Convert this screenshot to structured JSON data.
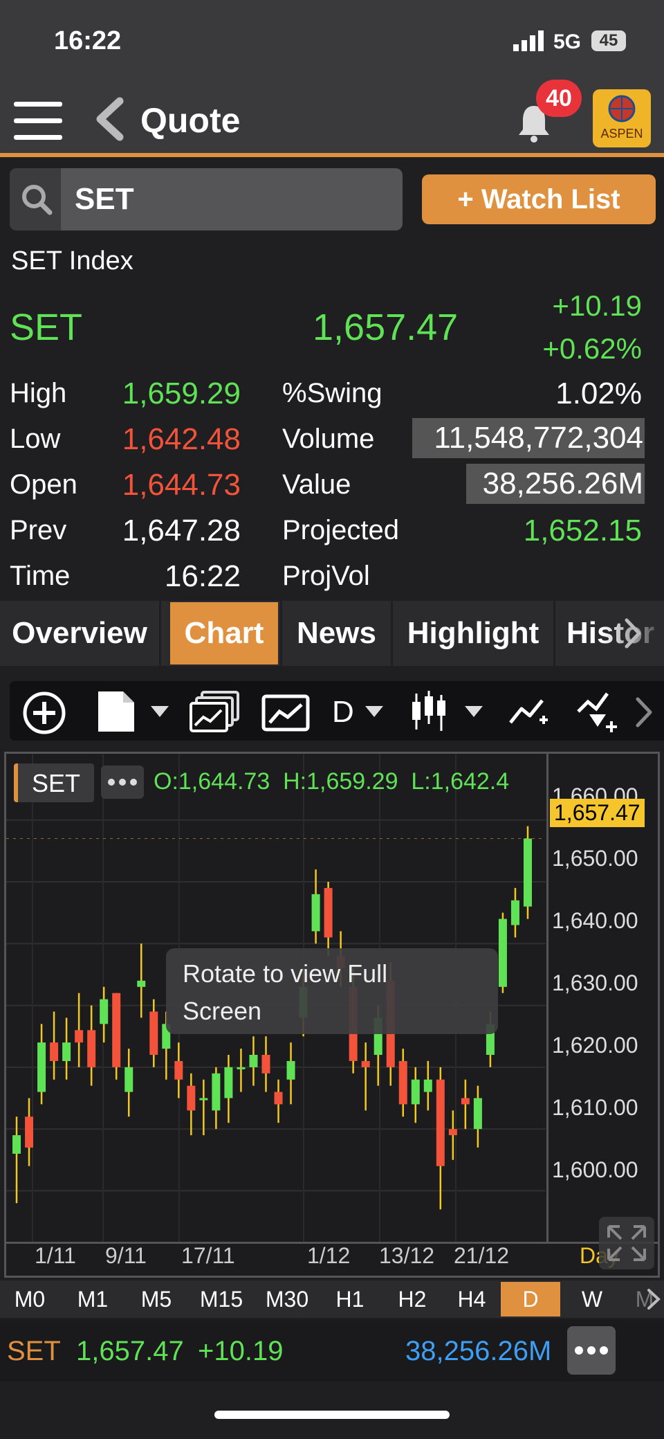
{
  "status": {
    "time": "16:22",
    "network": "5G",
    "battery": "45"
  },
  "header": {
    "title": "Quote",
    "notifications": "40",
    "brand": "ASPEN"
  },
  "search": {
    "value": "SET",
    "watchlist_label": "+ Watch List"
  },
  "quote": {
    "name": "SET Index",
    "symbol": "SET",
    "last": "1,657.47",
    "change": "+10.19",
    "change_pct": "+0.62%",
    "high_label": "High",
    "high": "1,659.29",
    "low_label": "Low",
    "low": "1,642.48",
    "open_label": "Open",
    "open": "1,644.73",
    "prev_label": "Prev",
    "prev": "1,647.28",
    "time_label": "Time",
    "time": "16:22",
    "swing_label": "%Swing",
    "swing": "1.02%",
    "volume_label": "Volume",
    "volume": "11,548,772,304",
    "value_label": "Value",
    "value": "38,256.26M",
    "projected_label": "Projected",
    "projected": "1,652.15",
    "projvol_label": "ProjVol"
  },
  "tabs": [
    "Overview",
    "Chart",
    "News",
    "Highlight",
    "Histor"
  ],
  "toolbar": {
    "period": "D"
  },
  "chart_header": {
    "symbol": "SET",
    "ohl": "O:1,644.73  H:1,659.29  L:1,642.4"
  },
  "tooltip": {
    "line1": "Rotate to view Full",
    "line2": "Screen"
  },
  "chart_data": {
    "type": "candlestick",
    "y_ticks": [
      "1,660.00",
      "1,650.00",
      "1,640.00",
      "1,630.00",
      "1,620.00",
      "1,610.00",
      "1,600.00"
    ],
    "last_price_label": "1,657.47",
    "x_ticks": [
      "1/11",
      "9/11",
      "17/11",
      "1/12",
      "13/12",
      "21/12"
    ],
    "period_label": "Day",
    "ylim": [
      1594,
      1664
    ],
    "candles": [
      {
        "o": 1606,
        "c": 1609,
        "h": 1612,
        "l": 1598
      },
      {
        "o": 1612,
        "c": 1607,
        "h": 1615,
        "l": 1604
      },
      {
        "o": 1616,
        "c": 1624,
        "h": 1627,
        "l": 1614
      },
      {
        "o": 1624,
        "c": 1621,
        "h": 1629,
        "l": 1618
      },
      {
        "o": 1621,
        "c": 1624,
        "h": 1628,
        "l": 1618
      },
      {
        "o": 1626,
        "c": 1624,
        "h": 1632,
        "l": 1620
      },
      {
        "o": 1626,
        "c": 1620,
        "h": 1630,
        "l": 1617
      },
      {
        "o": 1627,
        "c": 1631,
        "h": 1633,
        "l": 1624
      },
      {
        "o": 1632,
        "c": 1620,
        "h": 1632,
        "l": 1618
      },
      {
        "o": 1616,
        "c": 1620,
        "h": 1623,
        "l": 1612
      },
      {
        "o": 1633,
        "c": 1634,
        "h": 1640,
        "l": 1628
      },
      {
        "o": 1629,
        "c": 1622,
        "h": 1631,
        "l": 1620
      },
      {
        "o": 1623,
        "c": 1627,
        "h": 1629,
        "l": 1618
      },
      {
        "o": 1621,
        "c": 1618,
        "h": 1624,
        "l": 1615
      },
      {
        "o": 1617,
        "c": 1613,
        "h": 1619,
        "l": 1609
      },
      {
        "o": 1615,
        "c": 1615,
        "h": 1618,
        "l": 1609
      },
      {
        "o": 1613,
        "c": 1619,
        "h": 1620,
        "l": 1610
      },
      {
        "o": 1615,
        "c": 1620,
        "h": 1622,
        "l": 1611
      },
      {
        "o": 1620,
        "c": 1620,
        "h": 1623,
        "l": 1616
      },
      {
        "o": 1620,
        "c": 1622,
        "h": 1625,
        "l": 1617
      },
      {
        "o": 1622,
        "c": 1619,
        "h": 1625,
        "l": 1616
      },
      {
        "o": 1616,
        "c": 1614,
        "h": 1618,
        "l": 1611
      },
      {
        "o": 1618,
        "c": 1621,
        "h": 1624,
        "l": 1614
      },
      {
        "o": 1628,
        "c": 1633,
        "h": 1636,
        "l": 1625
      },
      {
        "o": 1642,
        "c": 1648,
        "h": 1652,
        "l": 1640
      },
      {
        "o": 1649,
        "c": 1641,
        "h": 1650,
        "l": 1638
      },
      {
        "o": 1638,
        "c": 1636,
        "h": 1642,
        "l": 1633
      },
      {
        "o": 1633,
        "c": 1621,
        "h": 1636,
        "l": 1619
      },
      {
        "o": 1621,
        "c": 1620,
        "h": 1624,
        "l": 1613
      },
      {
        "o": 1622,
        "c": 1628,
        "h": 1630,
        "l": 1617
      },
      {
        "o": 1634,
        "c": 1620,
        "h": 1637,
        "l": 1617
      },
      {
        "o": 1621,
        "c": 1614,
        "h": 1623,
        "l": 1612
      },
      {
        "o": 1614,
        "c": 1618,
        "h": 1620,
        "l": 1611
      },
      {
        "o": 1616,
        "c": 1618,
        "h": 1621,
        "l": 1613
      },
      {
        "o": 1618,
        "c": 1604,
        "h": 1620,
        "l": 1597
      },
      {
        "o": 1610,
        "c": 1609,
        "h": 1613,
        "l": 1605
      },
      {
        "o": 1615,
        "c": 1614,
        "h": 1618,
        "l": 1610
      },
      {
        "o": 1610,
        "c": 1615,
        "h": 1617,
        "l": 1607
      },
      {
        "o": 1622,
        "c": 1627,
        "h": 1629,
        "l": 1620
      },
      {
        "o": 1633,
        "c": 1644,
        "h": 1645,
        "l": 1632
      },
      {
        "o": 1643,
        "c": 1647,
        "h": 1649,
        "l": 1641
      },
      {
        "o": 1646,
        "c": 1657,
        "h": 1659,
        "l": 1644
      }
    ]
  },
  "intervals": [
    "M0",
    "M1",
    "M5",
    "M15",
    "M30",
    "H1",
    "H2",
    "H4",
    "D",
    "W",
    "M"
  ],
  "footer": {
    "symbol": "SET",
    "last": "1,657.47",
    "change": "+10.19",
    "value": "38,256.26M"
  },
  "colors": {
    "up": "#5fe255",
    "down": "#f2533a",
    "accent": "#e0913f",
    "wick": "#f3c81f"
  }
}
